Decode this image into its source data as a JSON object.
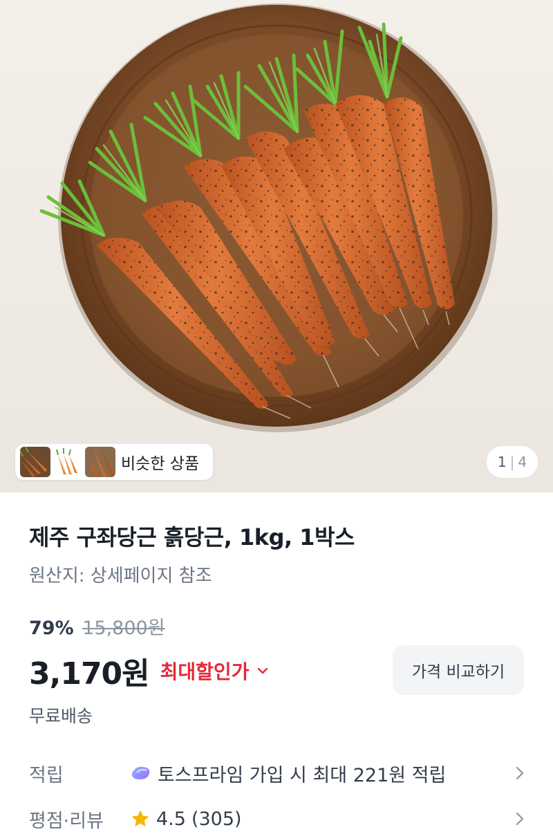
{
  "gallery": {
    "similar_label": "비슷한 상품",
    "page_current": "1",
    "page_total": "4",
    "icons": [
      "carrot-thumbnail-1",
      "carrot-thumbnail-2",
      "carrot-thumbnail-3"
    ]
  },
  "product": {
    "title": "제주 구좌당근 흙당근, 1kg, 1박스",
    "origin": "원산지: 상세페이지 참조",
    "discount_rate": "79%",
    "original_price": "15,800원",
    "price": "3,170원",
    "max_discount_label": "최대할인가",
    "compare_button": "가격 비교하기",
    "shipping": "무료배송"
  },
  "info_rows": [
    {
      "key": "적립",
      "value": "토스프라임 가입 시 최대 221원 적립",
      "icon": "toss-prime-icon"
    },
    {
      "key": "평점·리뷰",
      "rating": "4.5",
      "review_count": "(305)",
      "icon": "star-icon"
    }
  ],
  "colors": {
    "discount_red": "#e42939",
    "text_primary": "#191f28",
    "text_secondary": "#6b7684",
    "button_bg": "#f2f4f6",
    "star": "#f7b500"
  }
}
